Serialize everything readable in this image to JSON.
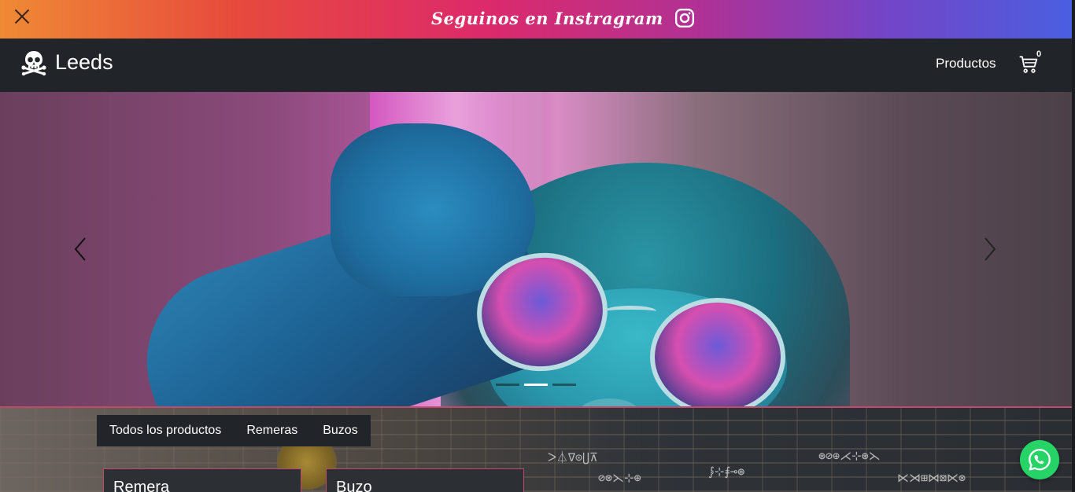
{
  "promo": {
    "text": "Seguinos en Instragram",
    "close_icon": "close-icon",
    "social_icon": "instagram-icon"
  },
  "navbar": {
    "brand_icon": "skull-crossbones-icon",
    "brand_name": "Leeds",
    "links": [
      {
        "label": "Productos"
      }
    ],
    "cart_icon": "cart-icon",
    "cart_count": "0"
  },
  "carousel": {
    "prev_icon": "chevron-left-icon",
    "next_icon": "chevron-right-icon",
    "slide_count": 3,
    "active_index": 1
  },
  "products": {
    "filters": [
      {
        "label": "Todos los productos"
      },
      {
        "label": "Remeras"
      },
      {
        "label": "Buzos"
      }
    ],
    "cards": [
      {
        "title": "Remera"
      },
      {
        "title": "Buzo"
      }
    ]
  },
  "whatsapp": {
    "icon": "whatsapp-icon"
  },
  "colors": {
    "navbar_bg": "#212529",
    "promo_gradient_start": "#ef8a34",
    "promo_gradient_end": "#4a5fe0",
    "card_border": "#c04a6a",
    "whatsapp_green": "#25d366"
  }
}
